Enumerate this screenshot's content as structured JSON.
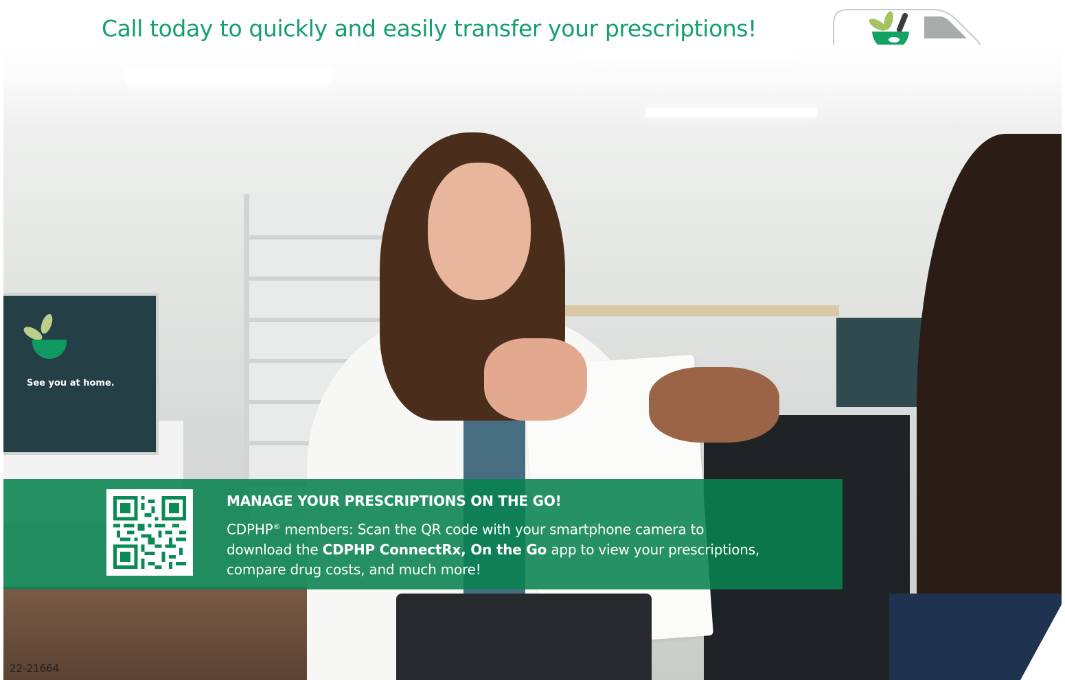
{
  "header": {
    "headline": "Call today to quickly and easily transfer your prescriptions!",
    "van_icon": "delivery-van-icon",
    "accent_color": "#13a06a"
  },
  "photo": {
    "monitor_text": "See you at home."
  },
  "promo": {
    "background_color": "#088250",
    "qr_icon": "qr-code-icon",
    "title": "MANAGE YOUR PRESCRIPTIONS ON THE GO!",
    "line1_prefix": "CDPHP",
    "line1_reg": "®",
    "line1_rest": " members: Scan the QR code with your smartphone camera to",
    "line2_prefix": "download the ",
    "line2_bold": "CDPHP ConnectRx, On the Go",
    "line2_rest": " app to view your prescriptions,",
    "line3": "compare drug costs, and much more!"
  },
  "footer": {
    "code": "22-21664"
  }
}
